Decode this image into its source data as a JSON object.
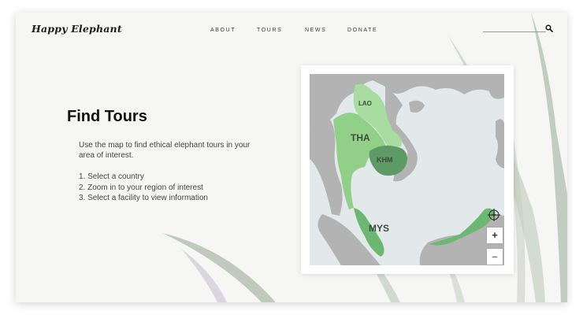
{
  "header": {
    "logo_text": "Happy Elephant",
    "nav": [
      "ABOUT",
      "TOURS",
      "NEWS",
      "DONATE"
    ],
    "search_icon": "search-icon"
  },
  "main": {
    "title": "Find Tours",
    "intro": "Use the map to find ethical elephant tours in your area of interest.",
    "steps": [
      "1. Select a country",
      "2. Zoom in to your region of interest",
      "3. Select a facility to view information"
    ]
  },
  "map": {
    "countries": [
      {
        "code": "LAO",
        "color": "#a8dca0"
      },
      {
        "code": "THA",
        "color": "#92d08a"
      },
      {
        "code": "KHM",
        "color": "#5e9a66"
      },
      {
        "code": "MYS",
        "color": "#6cb872"
      }
    ],
    "water_color": "#e3e9ea",
    "land_color": "#b3b3b3",
    "controls": {
      "zoom_in": "+",
      "zoom_out": "–",
      "compass_icon": "compass-icon"
    }
  },
  "colors": {
    "accent": "#5e9a66",
    "background": "#f6f6f4"
  }
}
